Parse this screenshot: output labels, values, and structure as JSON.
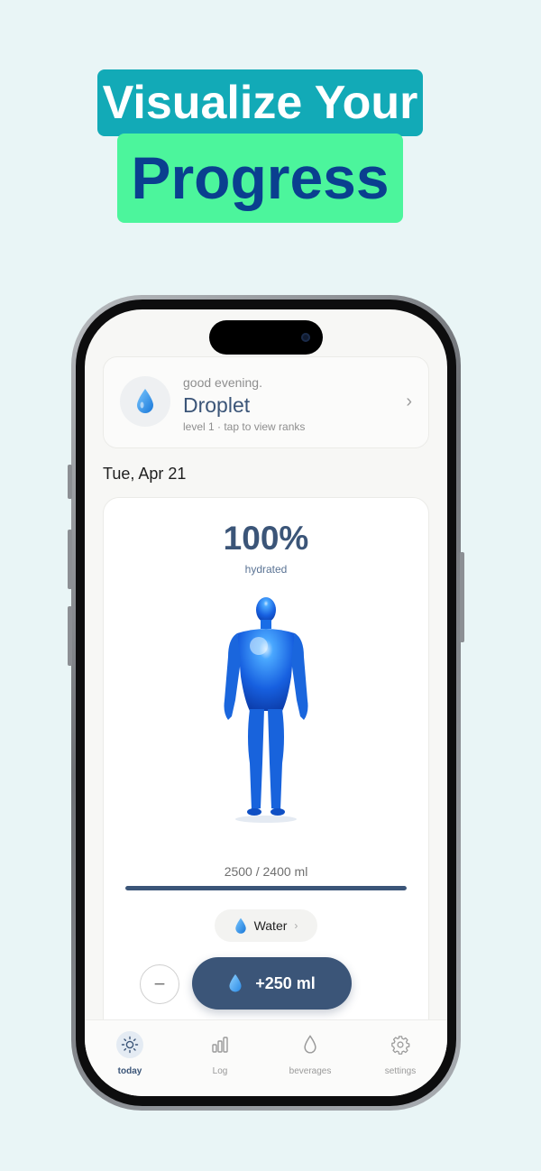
{
  "headline": {
    "line1": "Visualize Your",
    "line2": "Progress"
  },
  "profile": {
    "greeting": "good evening.",
    "name": "Droplet",
    "level": "level 1  ·  tap to view ranks",
    "avatar_icon": "water-drop-icon"
  },
  "date": "Tue, Apr 21",
  "hydration": {
    "percent_text": "100%",
    "status": "hydrated",
    "amount_text": "2500 / 2400 ml",
    "progress": 1.0
  },
  "beverage": {
    "label": "Water",
    "icon": "water-drop-icon"
  },
  "actions": {
    "decrement": "−",
    "add_label": "+250 ml"
  },
  "tabs": [
    {
      "label": "today",
      "icon": "sun-icon",
      "active": true
    },
    {
      "label": "Log",
      "icon": "bar-chart-icon",
      "active": false
    },
    {
      "label": "beverages",
      "icon": "drop-outline-icon",
      "active": false
    },
    {
      "label": "settings",
      "icon": "gear-icon",
      "active": false
    }
  ],
  "colors": {
    "accent": "#3b5578",
    "headline_teal": "#12aab7",
    "headline_green": "#4cf59c",
    "headline_navy": "#0a3f8f",
    "water_blue": "#1e8fe8"
  }
}
